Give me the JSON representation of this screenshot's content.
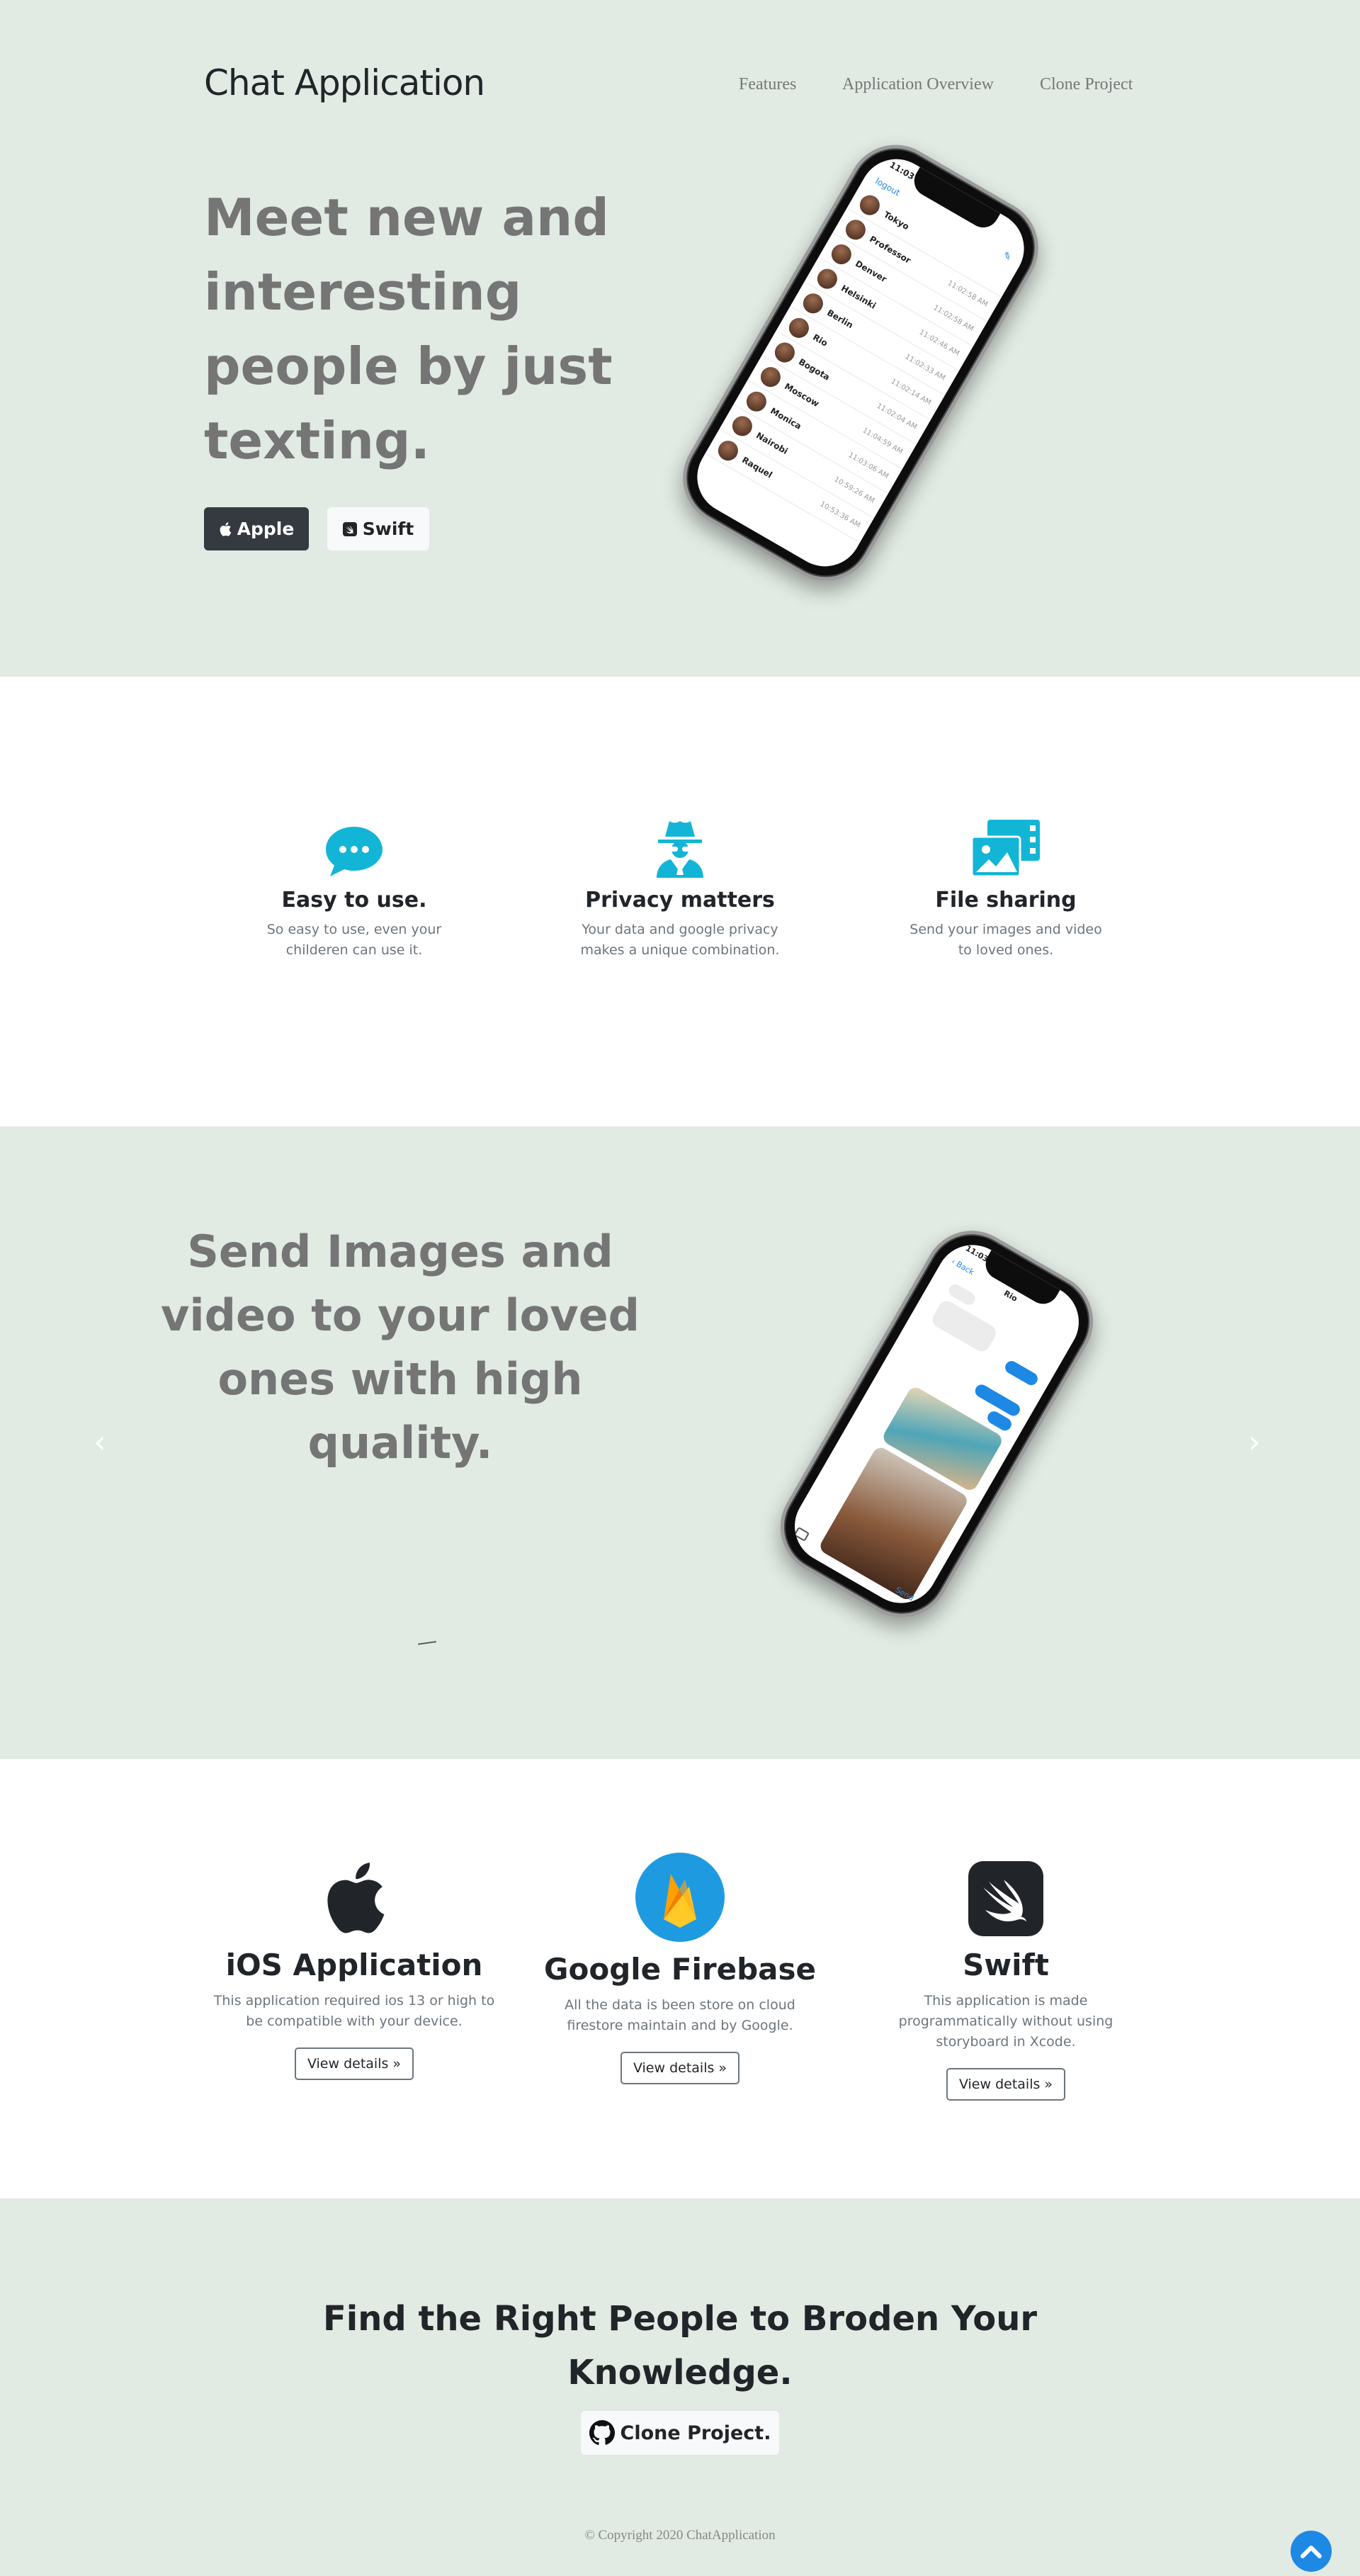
{
  "header": {
    "brand": "Chat Application",
    "nav": [
      "Features",
      "Application Overview",
      "Clone Project"
    ]
  },
  "hero": {
    "title": "Meet new and interesting people by just texting.",
    "buttons": {
      "apple": "Apple",
      "swift": "Swift"
    }
  },
  "hero_phone": {
    "time": "11:03",
    "logout": "logout",
    "chats": [
      {
        "name": "Tokyo",
        "time": ""
      },
      {
        "name": "Professor",
        "time": "11:02:58 AM"
      },
      {
        "name": "Denver",
        "time": "11:02:58 AM"
      },
      {
        "name": "Helsinki",
        "time": "11:02:46 AM"
      },
      {
        "name": "Berlin",
        "time": "11:02:33 AM"
      },
      {
        "name": "Rio",
        "time": "11:02:14 AM"
      },
      {
        "name": "Bogota",
        "time": "11:02:04 AM"
      },
      {
        "name": "Moscow",
        "time": "11:04:59 AM"
      },
      {
        "name": "Monica",
        "time": "11:03:06 AM"
      },
      {
        "name": "Nairobi",
        "time": "10:59:26 AM"
      },
      {
        "name": "Raquel",
        "time": "10:53:36 AM"
      }
    ]
  },
  "features": [
    {
      "title": "Easy to use.",
      "text": "So easy to use, even your childeren can use it.",
      "icon": "chat-bubble-icon"
    },
    {
      "title": "Privacy matters",
      "text": "Your data and google privacy makes a unique combination.",
      "icon": "spy-icon"
    },
    {
      "title": "File sharing",
      "text": "Send your images and video to loved ones.",
      "icon": "photo-video-icon"
    }
  ],
  "slide": {
    "title": "Send Images and video to your loved ones with high quality.",
    "prev": "‹",
    "next": "›"
  },
  "slide_phone": {
    "time": "11:03",
    "back": "Back",
    "contact": "Rio",
    "send": "Send"
  },
  "tech": [
    {
      "title": "iOS Application",
      "text": "This application required ios 13 or high to be compatible with your device.",
      "button": "View details »",
      "icon": "apple-icon"
    },
    {
      "title": "Google Firebase",
      "text": "All the data is been store on cloud firestore maintain and by Google.",
      "button": "View details »",
      "icon": "firebase-icon"
    },
    {
      "title": "Swift",
      "text": "This application is made programmatically without using storyboard in Xcode.",
      "button": "View details »",
      "icon": "swift-icon"
    }
  ],
  "cta": {
    "title": "Find the Right People to Broden Your Knowledge.",
    "button": "Clone Project."
  },
  "footer": {
    "copyright": "© Copyright 2020 ChatApplication"
  },
  "colors": {
    "section_bg": "#e1eae3",
    "accent_cyan": "#13b5d6",
    "dark_button": "#343a40",
    "scroll_top": "#1e88e5"
  }
}
